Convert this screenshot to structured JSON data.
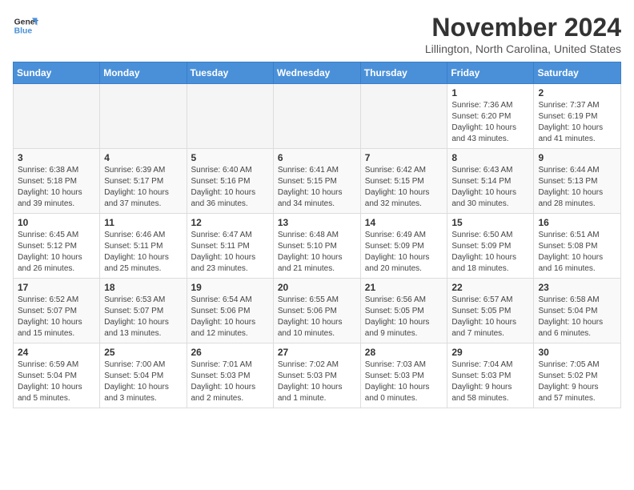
{
  "logo": {
    "line1": "General",
    "line2": "Blue"
  },
  "title": "November 2024",
  "location": "Lillington, North Carolina, United States",
  "days_of_week": [
    "Sunday",
    "Monday",
    "Tuesday",
    "Wednesday",
    "Thursday",
    "Friday",
    "Saturday"
  ],
  "weeks": [
    [
      {
        "day": "",
        "info": ""
      },
      {
        "day": "",
        "info": ""
      },
      {
        "day": "",
        "info": ""
      },
      {
        "day": "",
        "info": ""
      },
      {
        "day": "",
        "info": ""
      },
      {
        "day": "1",
        "info": "Sunrise: 7:36 AM\nSunset: 6:20 PM\nDaylight: 10 hours\nand 43 minutes."
      },
      {
        "day": "2",
        "info": "Sunrise: 7:37 AM\nSunset: 6:19 PM\nDaylight: 10 hours\nand 41 minutes."
      }
    ],
    [
      {
        "day": "3",
        "info": "Sunrise: 6:38 AM\nSunset: 5:18 PM\nDaylight: 10 hours\nand 39 minutes."
      },
      {
        "day": "4",
        "info": "Sunrise: 6:39 AM\nSunset: 5:17 PM\nDaylight: 10 hours\nand 37 minutes."
      },
      {
        "day": "5",
        "info": "Sunrise: 6:40 AM\nSunset: 5:16 PM\nDaylight: 10 hours\nand 36 minutes."
      },
      {
        "day": "6",
        "info": "Sunrise: 6:41 AM\nSunset: 5:15 PM\nDaylight: 10 hours\nand 34 minutes."
      },
      {
        "day": "7",
        "info": "Sunrise: 6:42 AM\nSunset: 5:15 PM\nDaylight: 10 hours\nand 32 minutes."
      },
      {
        "day": "8",
        "info": "Sunrise: 6:43 AM\nSunset: 5:14 PM\nDaylight: 10 hours\nand 30 minutes."
      },
      {
        "day": "9",
        "info": "Sunrise: 6:44 AM\nSunset: 5:13 PM\nDaylight: 10 hours\nand 28 minutes."
      }
    ],
    [
      {
        "day": "10",
        "info": "Sunrise: 6:45 AM\nSunset: 5:12 PM\nDaylight: 10 hours\nand 26 minutes."
      },
      {
        "day": "11",
        "info": "Sunrise: 6:46 AM\nSunset: 5:11 PM\nDaylight: 10 hours\nand 25 minutes."
      },
      {
        "day": "12",
        "info": "Sunrise: 6:47 AM\nSunset: 5:11 PM\nDaylight: 10 hours\nand 23 minutes."
      },
      {
        "day": "13",
        "info": "Sunrise: 6:48 AM\nSunset: 5:10 PM\nDaylight: 10 hours\nand 21 minutes."
      },
      {
        "day": "14",
        "info": "Sunrise: 6:49 AM\nSunset: 5:09 PM\nDaylight: 10 hours\nand 20 minutes."
      },
      {
        "day": "15",
        "info": "Sunrise: 6:50 AM\nSunset: 5:09 PM\nDaylight: 10 hours\nand 18 minutes."
      },
      {
        "day": "16",
        "info": "Sunrise: 6:51 AM\nSunset: 5:08 PM\nDaylight: 10 hours\nand 16 minutes."
      }
    ],
    [
      {
        "day": "17",
        "info": "Sunrise: 6:52 AM\nSunset: 5:07 PM\nDaylight: 10 hours\nand 15 minutes."
      },
      {
        "day": "18",
        "info": "Sunrise: 6:53 AM\nSunset: 5:07 PM\nDaylight: 10 hours\nand 13 minutes."
      },
      {
        "day": "19",
        "info": "Sunrise: 6:54 AM\nSunset: 5:06 PM\nDaylight: 10 hours\nand 12 minutes."
      },
      {
        "day": "20",
        "info": "Sunrise: 6:55 AM\nSunset: 5:06 PM\nDaylight: 10 hours\nand 10 minutes."
      },
      {
        "day": "21",
        "info": "Sunrise: 6:56 AM\nSunset: 5:05 PM\nDaylight: 10 hours\nand 9 minutes."
      },
      {
        "day": "22",
        "info": "Sunrise: 6:57 AM\nSunset: 5:05 PM\nDaylight: 10 hours\nand 7 minutes."
      },
      {
        "day": "23",
        "info": "Sunrise: 6:58 AM\nSunset: 5:04 PM\nDaylight: 10 hours\nand 6 minutes."
      }
    ],
    [
      {
        "day": "24",
        "info": "Sunrise: 6:59 AM\nSunset: 5:04 PM\nDaylight: 10 hours\nand 5 minutes."
      },
      {
        "day": "25",
        "info": "Sunrise: 7:00 AM\nSunset: 5:04 PM\nDaylight: 10 hours\nand 3 minutes."
      },
      {
        "day": "26",
        "info": "Sunrise: 7:01 AM\nSunset: 5:03 PM\nDaylight: 10 hours\nand 2 minutes."
      },
      {
        "day": "27",
        "info": "Sunrise: 7:02 AM\nSunset: 5:03 PM\nDaylight: 10 hours\nand 1 minute."
      },
      {
        "day": "28",
        "info": "Sunrise: 7:03 AM\nSunset: 5:03 PM\nDaylight: 10 hours\nand 0 minutes."
      },
      {
        "day": "29",
        "info": "Sunrise: 7:04 AM\nSunset: 5:03 PM\nDaylight: 9 hours\nand 58 minutes."
      },
      {
        "day": "30",
        "info": "Sunrise: 7:05 AM\nSunset: 5:02 PM\nDaylight: 9 hours\nand 57 minutes."
      }
    ]
  ]
}
